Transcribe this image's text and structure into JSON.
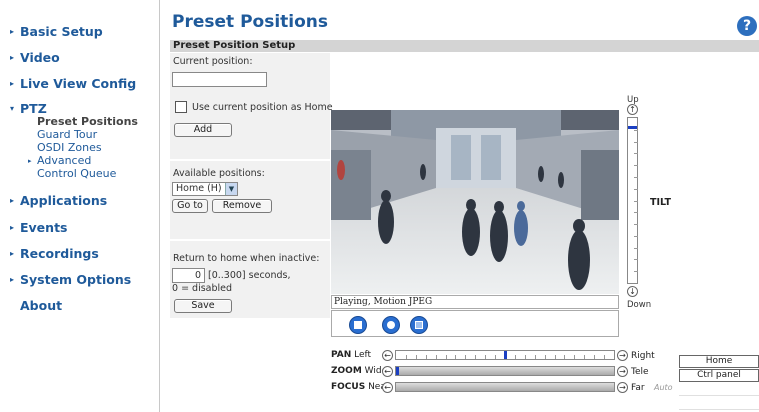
{
  "sidebar": {
    "items": [
      {
        "label": "Basic Setup",
        "arrow": "▸"
      },
      {
        "label": "Video",
        "arrow": "▸"
      },
      {
        "label": "Live View Config",
        "arrow": "▸"
      },
      {
        "label": "PTZ",
        "arrow": "▾"
      },
      {
        "label": "Applications",
        "arrow": "▸"
      },
      {
        "label": "Events",
        "arrow": "▸"
      },
      {
        "label": "Recordings",
        "arrow": "▸"
      },
      {
        "label": "System Options",
        "arrow": "▸"
      },
      {
        "label": "About",
        "arrow": ""
      }
    ],
    "ptz_subitems": [
      "Preset Positions",
      "Guard Tour",
      "OSDI Zones",
      "Advanced",
      "Control Queue"
    ],
    "advanced_arrow": "▸"
  },
  "header": {
    "title": "Preset Positions",
    "help_symbol": "?"
  },
  "section": {
    "title": "Preset Position Setup"
  },
  "form": {
    "current_position_label": "Current position:",
    "current_position_value": "",
    "home_checkbox_label": "Use current position as Home",
    "home_checked": false,
    "add_button": "Add",
    "available_label": "Available positions:",
    "available_selected": "Home (H)",
    "goto_button": "Go to",
    "remove_button": "Remove",
    "return_home_label": "Return to home when inactive:",
    "return_home_value": "0",
    "return_home_range": "[0..300] seconds,",
    "return_home_note": "0 = disabled",
    "save_button": "Save"
  },
  "video": {
    "status": "Playing, Motion JPEG"
  },
  "tilt": {
    "up_label": "Up",
    "down_label": "Down",
    "label": "TILT",
    "position_fraction": 0.05
  },
  "ptz": {
    "pan": {
      "label": "PAN",
      "left": "Left",
      "right": "Right",
      "position_fraction": 0.5
    },
    "zoom": {
      "label": "ZOOM",
      "left": "Wide",
      "right": "Tele",
      "position_fraction": 0.0
    },
    "focus": {
      "label": "FOCUS",
      "left": "Near",
      "right": "Far",
      "auto": "Auto"
    }
  },
  "side_buttons": {
    "home": "Home",
    "ctrl_panel": "Ctrl panel"
  },
  "colors": {
    "accent": "#1f5a9a",
    "slider_knob": "#1b3fc2",
    "video_button": "#2a6ed0"
  }
}
